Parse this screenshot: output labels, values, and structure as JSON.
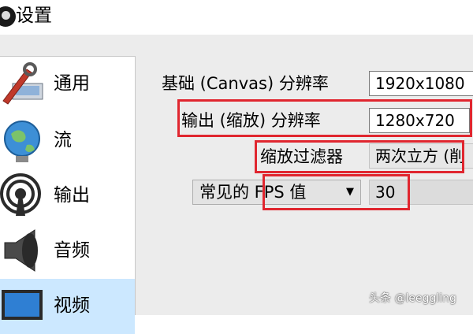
{
  "window": {
    "title": "设置"
  },
  "sidebar": {
    "items": [
      {
        "label": "通用",
        "icon": "general-settings-icon",
        "active": false
      },
      {
        "label": "流",
        "icon": "globe-stream-icon",
        "active": false
      },
      {
        "label": "输出",
        "icon": "broadcast-output-icon",
        "active": false
      },
      {
        "label": "音频",
        "icon": "speaker-icon",
        "active": false
      },
      {
        "label": "视频",
        "icon": "monitor-icon",
        "active": true
      }
    ]
  },
  "video": {
    "base_resolution_label": "基础 (Canvas) 分辨率",
    "base_resolution_value": "1920x1080",
    "output_resolution_label": "输出 (缩放) 分辨率",
    "output_resolution_value": "1280x720",
    "downscale_filter_label": "缩放过滤器",
    "downscale_filter_value": "两次立方 (削",
    "fps_mode_value": "常见的 FPS 值",
    "fps_value": "30"
  },
  "watermark": "头条 @leeggling",
  "colors": {
    "highlight": "#e0262f",
    "active_item": "#cce8ff",
    "panel_bg": "#ececec"
  }
}
